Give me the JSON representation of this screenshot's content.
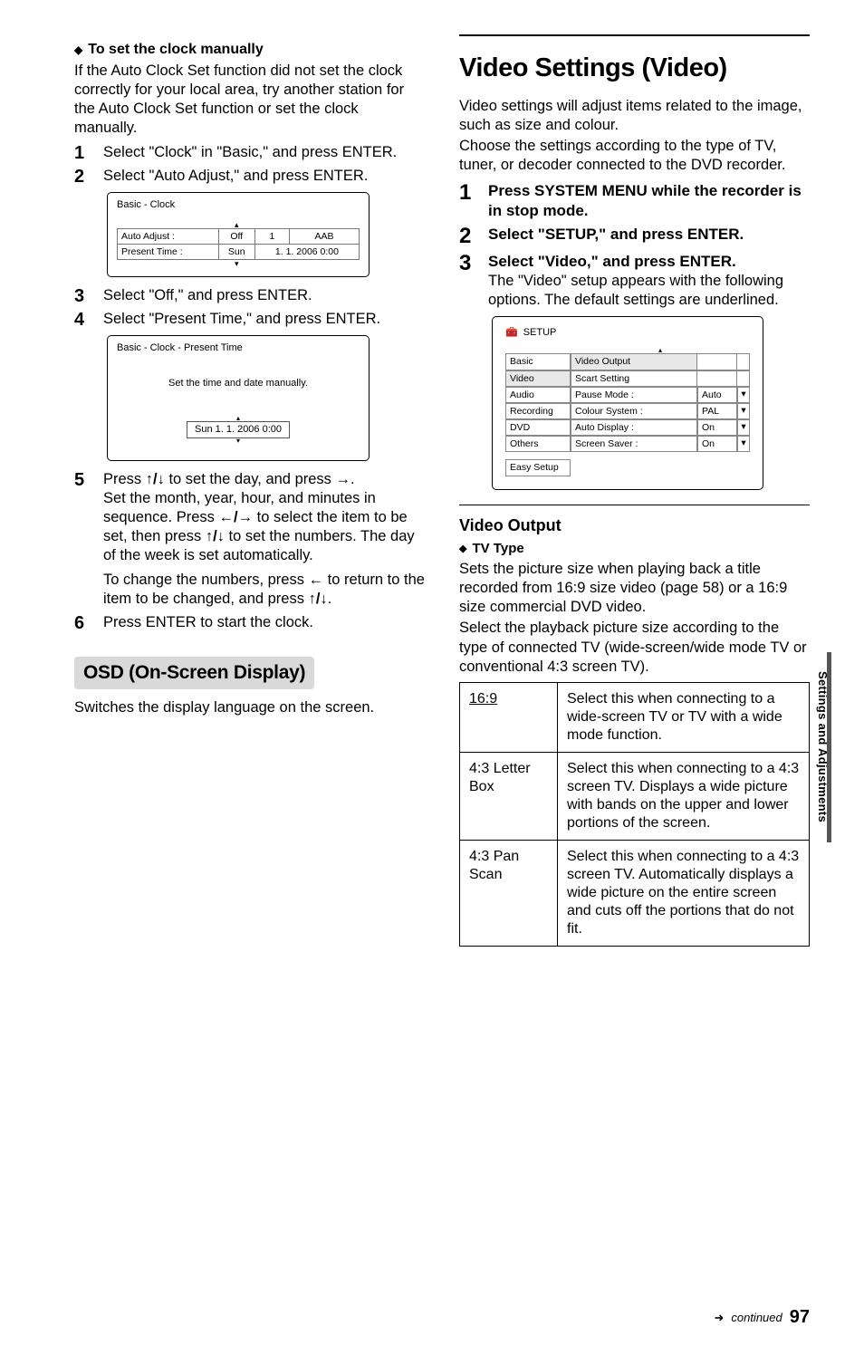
{
  "left": {
    "diamond1_title": "To set the clock manually",
    "intro": "If the Auto Clock Set function did not set the clock correctly for your local area, try another station for the Auto Clock Set function or set the clock manually.",
    "step1": "Select \"Clock\" in \"Basic,\" and press ENTER.",
    "step2": "Select \"Auto Adjust,\" and press ENTER.",
    "shot1": {
      "title": "Basic - Clock",
      "row1_label": "Auto Adjust :",
      "row1_v1": "Off",
      "row1_v2": "1",
      "row1_v3": "AAB",
      "row2_label": "Present Time :",
      "row2_v1": "Sun",
      "row2_v2": "1. 1. 2006  0:00"
    },
    "step3": "Select \"Off,\" and press ENTER.",
    "step4": "Select \"Present Time,\" and press ENTER.",
    "shot2": {
      "title": "Basic - Clock - Present Time",
      "msg": "Set the time and date manually.",
      "box": "Sun  1.    1.  2006   0:00"
    },
    "step5_a": "Press ",
    "step5_b": " to set the day, and press ",
    "step5_line2a": "Set the month, year, hour, and minutes in sequence. Press ",
    "step5_line2b": " to select the item to be set, then press ",
    "step5_line2c": " to set the numbers. The day of the week is set automatically.",
    "step5_para2a": "To change the numbers, press ",
    "step5_para2b": " to return to the item to be changed, and press ",
    "step6": "Press ENTER to start the clock.",
    "h2": "OSD (On-Screen Display)",
    "osd_text": "Switches the display language on the screen."
  },
  "right": {
    "h1": "Video Settings (Video)",
    "intro1": "Video settings will adjust items related to the image, such as size and colour.",
    "intro2": "Choose the settings according to the type of TV, tuner, or decoder connected to the DVD recorder.",
    "step1": "Press SYSTEM MENU while the recorder is in stop mode.",
    "step2": "Select \"SETUP,\" and press ENTER.",
    "step3_bold": "Select \"Video,\" and press ENTER.",
    "step3_text": "The \"Video\" setup appears with the following options. The default settings are underlined.",
    "setup_shot": {
      "hdr": "SETUP",
      "rows": [
        {
          "left": "Basic",
          "mid": "Video Output",
          "val": "",
          "ar": ""
        },
        {
          "left": "Video",
          "mid": "Scart Setting",
          "val": "",
          "ar": ""
        },
        {
          "left": "Audio",
          "mid": "Pause Mode :",
          "val": "Auto",
          "ar": "▾"
        },
        {
          "left": "Recording",
          "mid": "Colour System :",
          "val": "PAL",
          "ar": "▾"
        },
        {
          "left": "DVD",
          "mid": "Auto Display :",
          "val": "On",
          "ar": "▾"
        },
        {
          "left": "Others",
          "mid": "Screen Saver :",
          "val": "On",
          "ar": "▾"
        }
      ],
      "easy": "Easy Setup"
    },
    "vo_title": "Video Output",
    "tv_type": "TV Type",
    "tv_text1": "Sets the picture size when playing back a title recorded from 16:9 size video (page 58) or a 16:9 size commercial DVD video.",
    "tv_text2": "Select the playback picture size according to the type of connected TV (wide-screen/wide mode TV or conventional 4:3 screen TV).",
    "opts": [
      {
        "k": "16:9",
        "under": true,
        "v": "Select this when connecting to a wide-screen TV or TV with a wide mode function."
      },
      {
        "k": "4:3 Letter Box",
        "under": false,
        "v": "Select this when connecting to a 4:3 screen TV. Displays a wide picture with bands on the upper and lower portions of the screen."
      },
      {
        "k": "4:3 Pan Scan",
        "under": false,
        "v": "Select this when connecting to a 4:3 screen TV. Automatically displays a wide picture on the entire screen and cuts off the portions that do not fit."
      }
    ]
  },
  "side_label": "Settings and Adjustments",
  "footer_cont": "continued",
  "footer_page": "97"
}
